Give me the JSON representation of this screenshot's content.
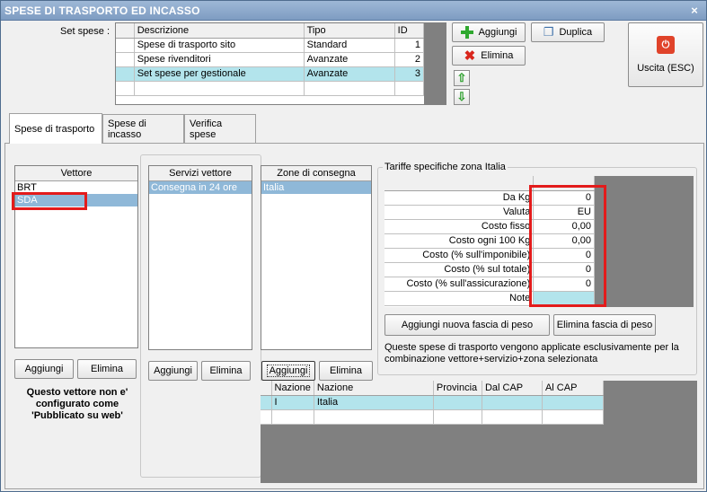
{
  "window": {
    "title": "SPESE DI TRASPORTO ED INCASSO",
    "close": "×"
  },
  "set_spese": {
    "label": "Set spese :",
    "columns": [
      "Descrizione",
      "Tipo",
      "ID"
    ],
    "rows": [
      {
        "descrizione": "Spese di trasporto sito",
        "tipo": "Standard",
        "id": "1"
      },
      {
        "descrizione": "Spese rivenditori",
        "tipo": "Avanzate",
        "id": "2"
      },
      {
        "descrizione": "Set spese per gestionale",
        "tipo": "Avanzate",
        "id": "3"
      }
    ]
  },
  "toolbar": {
    "aggiungi": "Aggiungi",
    "elimina": "Elimina",
    "duplica": "Duplica",
    "uscita": "Uscita (ESC)",
    "up": "⇧",
    "down": "⇩"
  },
  "tabs": [
    "Spese di trasporto",
    "Spese di incasso",
    "Verifica spese"
  ],
  "vettore": {
    "header": "Vettore",
    "items": [
      "BRT",
      "SDA"
    ],
    "aggiungi": "Aggiungi",
    "elimina": "Elimina",
    "warning": "Questo vettore non e' configurato come 'Pubblicato su web'"
  },
  "servizi": {
    "header": "Servizi vettore",
    "items": [
      "Consegna in 24 ore"
    ],
    "aggiungi": "Aggiungi",
    "elimina": "Elimina"
  },
  "zone": {
    "header": "Zone di consegna",
    "items": [
      "Italia"
    ],
    "aggiungi": "Aggiungi",
    "elimina": "Elimina"
  },
  "tariffe": {
    "title": "Tariffe specifiche zona Italia",
    "rows": [
      {
        "label": "Da Kg",
        "value": "0"
      },
      {
        "label": "Valuta",
        "value": "EU"
      },
      {
        "label": "Costo fisso",
        "value": "0,00"
      },
      {
        "label": "Costo ogni 100 Kg",
        "value": "0,00"
      },
      {
        "label": "Costo (% sull'imponibile)",
        "value": "0"
      },
      {
        "label": "Costo (% sul totale)",
        "value": "0"
      },
      {
        "label": "Costo (% sull'assicurazione)",
        "value": "0"
      },
      {
        "label": "Note",
        "value": ""
      }
    ],
    "aggiungi_fascia": "Aggiungi nuova fascia di peso",
    "elimina_fascia": "Elimina fascia di peso",
    "info": "Queste spese di trasporto vengono applicate esclusivamente per la combinazione vettore+servizio+zona selezionata"
  },
  "nazioni": {
    "columns": [
      "Nazione",
      "Nazione",
      "Provincia",
      "Dal CAP",
      "Al CAP"
    ],
    "rows": [
      {
        "code": "I",
        "name": "Italia",
        "provincia": "",
        "dal": "",
        "al": ""
      }
    ]
  }
}
